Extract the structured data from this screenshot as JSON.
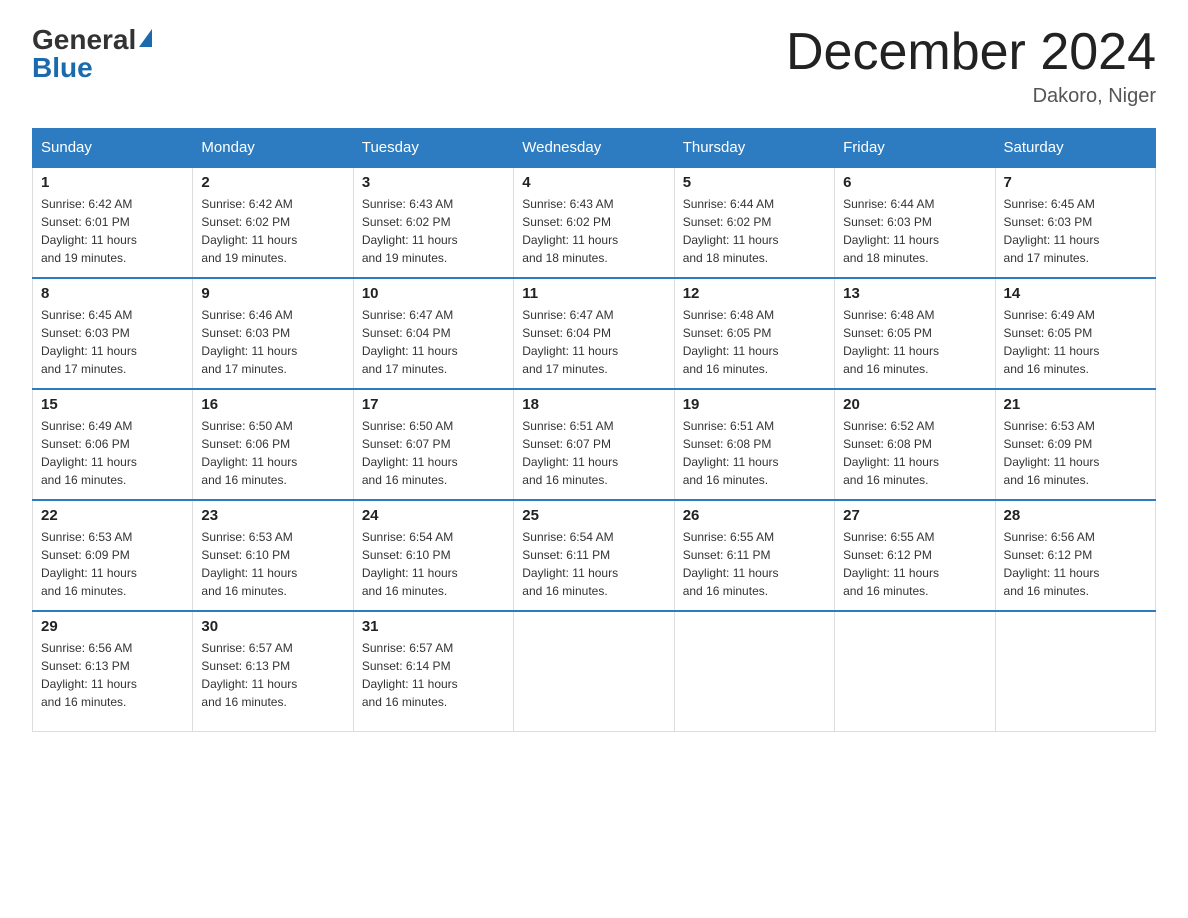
{
  "header": {
    "logo_line1": "General",
    "logo_line2": "Blue",
    "month_title": "December 2024",
    "location": "Dakoro, Niger"
  },
  "days_of_week": [
    "Sunday",
    "Monday",
    "Tuesday",
    "Wednesday",
    "Thursday",
    "Friday",
    "Saturday"
  ],
  "weeks": [
    [
      {
        "num": "1",
        "detail": "Sunrise: 6:42 AM\nSunset: 6:01 PM\nDaylight: 11 hours\nand 19 minutes."
      },
      {
        "num": "2",
        "detail": "Sunrise: 6:42 AM\nSunset: 6:02 PM\nDaylight: 11 hours\nand 19 minutes."
      },
      {
        "num": "3",
        "detail": "Sunrise: 6:43 AM\nSunset: 6:02 PM\nDaylight: 11 hours\nand 19 minutes."
      },
      {
        "num": "4",
        "detail": "Sunrise: 6:43 AM\nSunset: 6:02 PM\nDaylight: 11 hours\nand 18 minutes."
      },
      {
        "num": "5",
        "detail": "Sunrise: 6:44 AM\nSunset: 6:02 PM\nDaylight: 11 hours\nand 18 minutes."
      },
      {
        "num": "6",
        "detail": "Sunrise: 6:44 AM\nSunset: 6:03 PM\nDaylight: 11 hours\nand 18 minutes."
      },
      {
        "num": "7",
        "detail": "Sunrise: 6:45 AM\nSunset: 6:03 PM\nDaylight: 11 hours\nand 17 minutes."
      }
    ],
    [
      {
        "num": "8",
        "detail": "Sunrise: 6:45 AM\nSunset: 6:03 PM\nDaylight: 11 hours\nand 17 minutes."
      },
      {
        "num": "9",
        "detail": "Sunrise: 6:46 AM\nSunset: 6:03 PM\nDaylight: 11 hours\nand 17 minutes."
      },
      {
        "num": "10",
        "detail": "Sunrise: 6:47 AM\nSunset: 6:04 PM\nDaylight: 11 hours\nand 17 minutes."
      },
      {
        "num": "11",
        "detail": "Sunrise: 6:47 AM\nSunset: 6:04 PM\nDaylight: 11 hours\nand 17 minutes."
      },
      {
        "num": "12",
        "detail": "Sunrise: 6:48 AM\nSunset: 6:05 PM\nDaylight: 11 hours\nand 16 minutes."
      },
      {
        "num": "13",
        "detail": "Sunrise: 6:48 AM\nSunset: 6:05 PM\nDaylight: 11 hours\nand 16 minutes."
      },
      {
        "num": "14",
        "detail": "Sunrise: 6:49 AM\nSunset: 6:05 PM\nDaylight: 11 hours\nand 16 minutes."
      }
    ],
    [
      {
        "num": "15",
        "detail": "Sunrise: 6:49 AM\nSunset: 6:06 PM\nDaylight: 11 hours\nand 16 minutes."
      },
      {
        "num": "16",
        "detail": "Sunrise: 6:50 AM\nSunset: 6:06 PM\nDaylight: 11 hours\nand 16 minutes."
      },
      {
        "num": "17",
        "detail": "Sunrise: 6:50 AM\nSunset: 6:07 PM\nDaylight: 11 hours\nand 16 minutes."
      },
      {
        "num": "18",
        "detail": "Sunrise: 6:51 AM\nSunset: 6:07 PM\nDaylight: 11 hours\nand 16 minutes."
      },
      {
        "num": "19",
        "detail": "Sunrise: 6:51 AM\nSunset: 6:08 PM\nDaylight: 11 hours\nand 16 minutes."
      },
      {
        "num": "20",
        "detail": "Sunrise: 6:52 AM\nSunset: 6:08 PM\nDaylight: 11 hours\nand 16 minutes."
      },
      {
        "num": "21",
        "detail": "Sunrise: 6:53 AM\nSunset: 6:09 PM\nDaylight: 11 hours\nand 16 minutes."
      }
    ],
    [
      {
        "num": "22",
        "detail": "Sunrise: 6:53 AM\nSunset: 6:09 PM\nDaylight: 11 hours\nand 16 minutes."
      },
      {
        "num": "23",
        "detail": "Sunrise: 6:53 AM\nSunset: 6:10 PM\nDaylight: 11 hours\nand 16 minutes."
      },
      {
        "num": "24",
        "detail": "Sunrise: 6:54 AM\nSunset: 6:10 PM\nDaylight: 11 hours\nand 16 minutes."
      },
      {
        "num": "25",
        "detail": "Sunrise: 6:54 AM\nSunset: 6:11 PM\nDaylight: 11 hours\nand 16 minutes."
      },
      {
        "num": "26",
        "detail": "Sunrise: 6:55 AM\nSunset: 6:11 PM\nDaylight: 11 hours\nand 16 minutes."
      },
      {
        "num": "27",
        "detail": "Sunrise: 6:55 AM\nSunset: 6:12 PM\nDaylight: 11 hours\nand 16 minutes."
      },
      {
        "num": "28",
        "detail": "Sunrise: 6:56 AM\nSunset: 6:12 PM\nDaylight: 11 hours\nand 16 minutes."
      }
    ],
    [
      {
        "num": "29",
        "detail": "Sunrise: 6:56 AM\nSunset: 6:13 PM\nDaylight: 11 hours\nand 16 minutes."
      },
      {
        "num": "30",
        "detail": "Sunrise: 6:57 AM\nSunset: 6:13 PM\nDaylight: 11 hours\nand 16 minutes."
      },
      {
        "num": "31",
        "detail": "Sunrise: 6:57 AM\nSunset: 6:14 PM\nDaylight: 11 hours\nand 16 minutes."
      },
      null,
      null,
      null,
      null
    ]
  ]
}
